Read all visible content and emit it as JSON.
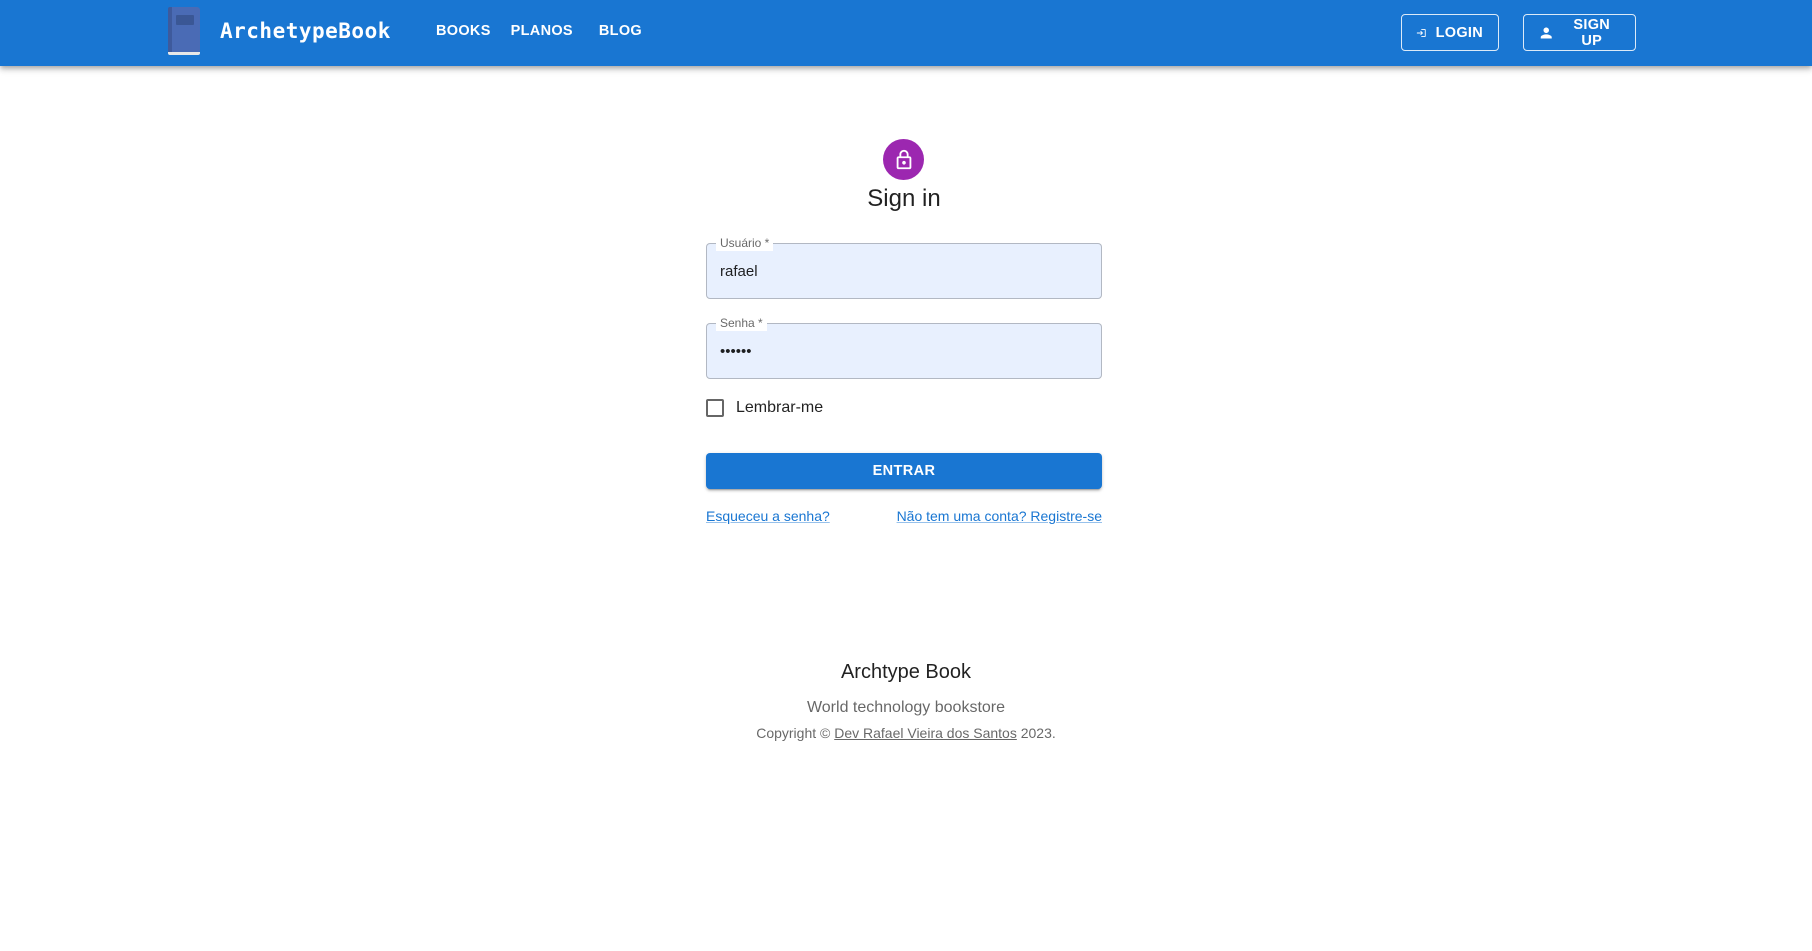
{
  "header": {
    "brand": "ArchetypeBook",
    "nav": [
      "BOOKS",
      "PLANOS",
      "BLOG"
    ],
    "login_label": "LOGIN",
    "signup_label": "SIGN UP"
  },
  "form": {
    "title": "Sign in",
    "username_label": "Usuário *",
    "username_value": "rafael",
    "password_label": "Senha *",
    "password_value": "••••••",
    "remember_label": "Lembrar-me",
    "submit_label": "ENTRAR",
    "forgot_link": "Esqueceu a senha?",
    "register_link": "Não tem uma conta? Registre-se"
  },
  "footer": {
    "title": "Archtype Book",
    "subtitle": "World technology bookstore",
    "copyright_prefix": "Copyright ©",
    "copyright_link": "Dev Rafael Vieira dos Santos",
    "copyright_year": "2023."
  },
  "icons": {
    "brand": "book-icon",
    "login": "login-icon",
    "signup": "person-icon",
    "avatar": "lock-icon"
  },
  "colors": {
    "primary": "#1976d2",
    "avatar": "#9c27b0",
    "autofill": "#e8f0fe"
  }
}
